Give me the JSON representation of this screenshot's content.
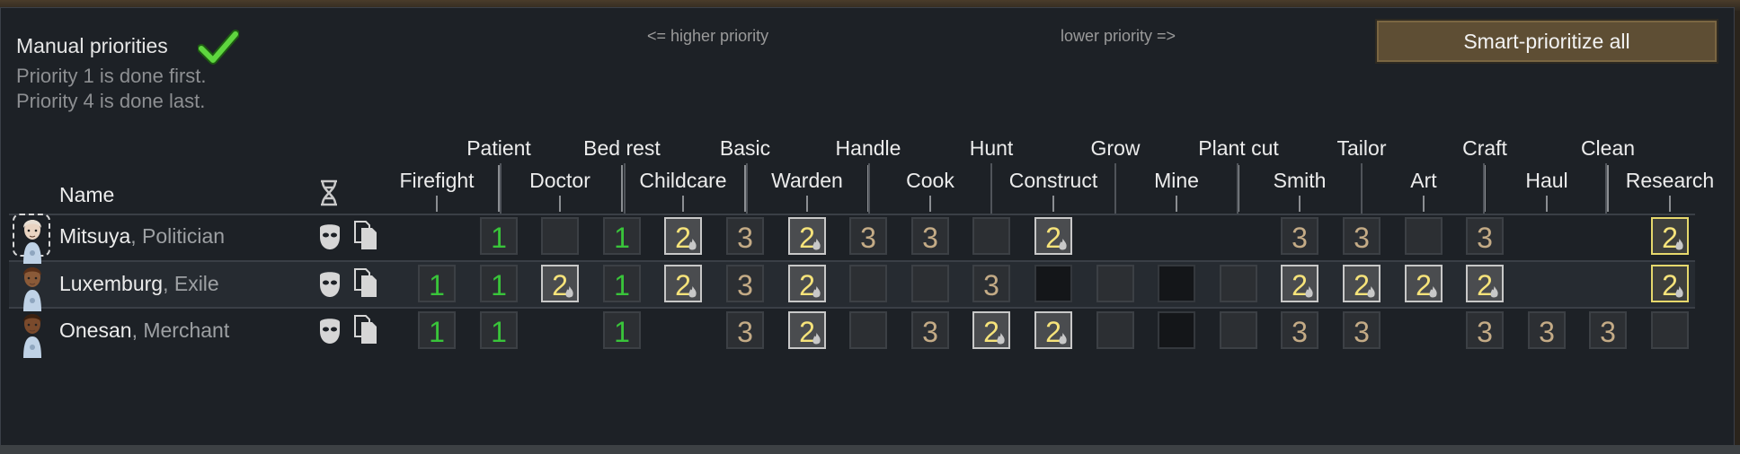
{
  "header": {
    "title": "Manual priorities",
    "subtitle1": "Priority 1 is done first.",
    "subtitle2": "Priority 4 is done last.",
    "higher_hint": "<= higher priority",
    "lower_hint": "lower priority =>",
    "smart_button": "Smart-prioritize all",
    "manual_enabled_icon": "checkmark-icon"
  },
  "columns_header": {
    "name": "Name"
  },
  "work_types": [
    "Firefight",
    "Patient",
    "Doctor",
    "Bed rest",
    "Childcare",
    "Basic",
    "Warden",
    "Handle",
    "Cook",
    "Hunt",
    "Construct",
    "Grow",
    "Mine",
    "Plant cut",
    "Smith",
    "Tailor",
    "Art",
    "Craft",
    "Haul",
    "Clean",
    "Research"
  ],
  "pawns": [
    {
      "name": "Mitsuya",
      "title": "Politician",
      "selected": true,
      "priorities": [
        "",
        "1",
        "e",
        "1",
        "2p",
        "3",
        "2p",
        "3",
        "3",
        "e",
        "2",
        "",
        "",
        "",
        "3",
        "3",
        "e",
        "3",
        "",
        "",
        "2h"
      ]
    },
    {
      "name": "Luxemburg",
      "title": "Exile",
      "selected": false,
      "priorities": [
        "1",
        "1",
        "2p",
        "1",
        "2p",
        "3",
        "2p",
        "e",
        "e",
        "3",
        "d",
        "e",
        "d",
        "e",
        "2p",
        "2p",
        "2p",
        "2p",
        "",
        "",
        "2h"
      ]
    },
    {
      "name": "Onesan",
      "title": "Merchant",
      "selected": false,
      "priorities": [
        "1",
        "1",
        "",
        "1",
        "",
        "3",
        "2p",
        "e",
        "3",
        "2",
        "2p",
        "e",
        "d",
        "e",
        "3",
        "3",
        "",
        "3",
        "3",
        "3",
        "e"
      ]
    }
  ],
  "colors": {
    "priority1": "#39c43a",
    "priority2": "#f6e37a",
    "priority3": "#c4ab86",
    "panel": "#1d2126"
  }
}
